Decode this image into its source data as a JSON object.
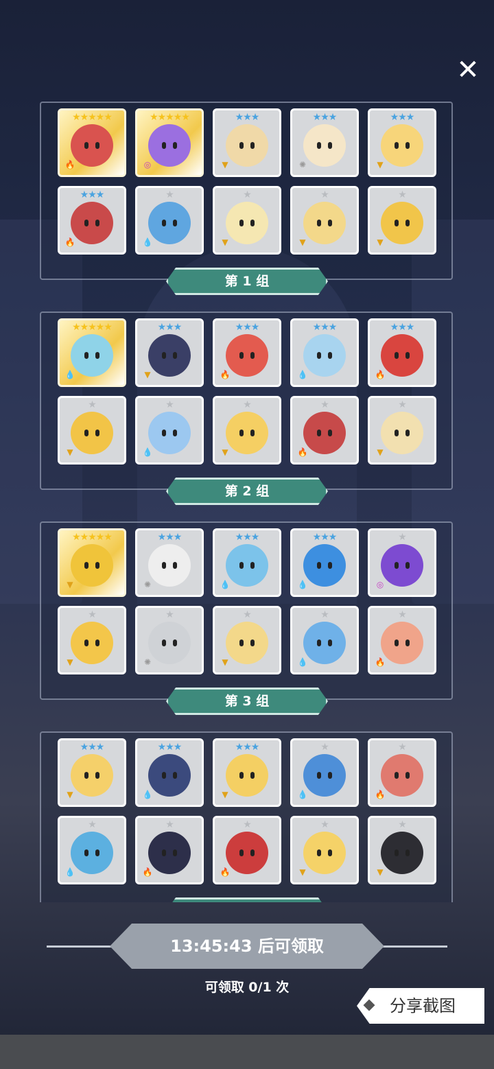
{
  "close_label": "✕",
  "groups": [
    {
      "label": "第 1 组",
      "cards": [
        {
          "stars": "★★★★★",
          "tier": "five",
          "gold": true,
          "color": "#d9534f",
          "elem": "fire"
        },
        {
          "stars": "★★★★★",
          "tier": "five",
          "gold": true,
          "color": "#9b6fe0",
          "elem": "arcane"
        },
        {
          "stars": "★★★",
          "tier": "three",
          "gold": false,
          "color": "#f0d9a8",
          "elem": "earth"
        },
        {
          "stars": "★★★",
          "tier": "three",
          "gold": false,
          "color": "#f5e6c8",
          "elem": "light"
        },
        {
          "stars": "★★★",
          "tier": "three",
          "gold": false,
          "color": "#f7d57a",
          "elem": "earth"
        },
        {
          "stars": "★★★",
          "tier": "three",
          "gold": false,
          "color": "#c94a4a",
          "elem": "fire"
        },
        {
          "stars": "★",
          "tier": "one",
          "gold": false,
          "color": "#5fa6e0",
          "elem": "water"
        },
        {
          "stars": "★",
          "tier": "one",
          "gold": false,
          "color": "#f5e7b2",
          "elem": "earth"
        },
        {
          "stars": "★",
          "tier": "one",
          "gold": false,
          "color": "#f3d88a",
          "elem": "earth"
        },
        {
          "stars": "★",
          "tier": "one",
          "gold": false,
          "color": "#f1c54a",
          "elem": "earth"
        }
      ]
    },
    {
      "label": "第 2 组",
      "cards": [
        {
          "stars": "★★★★★",
          "tier": "five",
          "gold": true,
          "color": "#8fd3e8",
          "elem": "water"
        },
        {
          "stars": "★★★",
          "tier": "three",
          "gold": false,
          "color": "#3a3f66",
          "elem": "earth"
        },
        {
          "stars": "★★★",
          "tier": "three",
          "gold": false,
          "color": "#e35b4f",
          "elem": "fire"
        },
        {
          "stars": "★★★",
          "tier": "three",
          "gold": false,
          "color": "#a8d4ef",
          "elem": "water"
        },
        {
          "stars": "★★★",
          "tier": "three",
          "gold": false,
          "color": "#d9453f",
          "elem": "fire"
        },
        {
          "stars": "★",
          "tier": "one",
          "gold": false,
          "color": "#f2c447",
          "elem": "earth"
        },
        {
          "stars": "★",
          "tier": "one",
          "gold": false,
          "color": "#9cc8f0",
          "elem": "water"
        },
        {
          "stars": "★",
          "tier": "one",
          "gold": false,
          "color": "#f5cf63",
          "elem": "earth"
        },
        {
          "stars": "★",
          "tier": "one",
          "gold": false,
          "color": "#c74a4a",
          "elem": "fire"
        },
        {
          "stars": "★",
          "tier": "one",
          "gold": false,
          "color": "#f2e0b0",
          "elem": "earth"
        }
      ]
    },
    {
      "label": "第 3 组",
      "cards": [
        {
          "stars": "★★★★★",
          "tier": "five",
          "gold": true,
          "color": "#f0c43a",
          "elem": "earth"
        },
        {
          "stars": "★★★",
          "tier": "three",
          "gold": false,
          "color": "#eeeeee",
          "elem": "light"
        },
        {
          "stars": "★★★",
          "tier": "three",
          "gold": false,
          "color": "#7cc3ea",
          "elem": "water"
        },
        {
          "stars": "★★★",
          "tier": "three",
          "gold": false,
          "color": "#3d8fe0",
          "elem": "water"
        },
        {
          "stars": "★",
          "tier": "one",
          "gold": false,
          "color": "#7d4bd1",
          "elem": "arcane"
        },
        {
          "stars": "★",
          "tier": "one",
          "gold": false,
          "color": "#f3c64a",
          "elem": "earth"
        },
        {
          "stars": "★",
          "tier": "one",
          "gold": false,
          "color": "#cfd2d6",
          "elem": "light"
        },
        {
          "stars": "★",
          "tier": "one",
          "gold": false,
          "color": "#f3d88a",
          "elem": "earth"
        },
        {
          "stars": "★",
          "tier": "one",
          "gold": false,
          "color": "#6fb1e8",
          "elem": "water"
        },
        {
          "stars": "★",
          "tier": "one",
          "gold": false,
          "color": "#f0a48a",
          "elem": "fire"
        }
      ]
    },
    {
      "label": "",
      "cards": [
        {
          "stars": "★★★",
          "tier": "three",
          "gold": false,
          "color": "#f5d06a",
          "elem": "earth"
        },
        {
          "stars": "★★★",
          "tier": "three",
          "gold": false,
          "color": "#3b4a7d",
          "elem": "water"
        },
        {
          "stars": "★★★",
          "tier": "three",
          "gold": false,
          "color": "#f4cf63",
          "elem": "earth"
        },
        {
          "stars": "★",
          "tier": "one",
          "gold": false,
          "color": "#4e8fd8",
          "elem": "water"
        },
        {
          "stars": "★",
          "tier": "one",
          "gold": false,
          "color": "#e07a6f",
          "elem": "fire"
        },
        {
          "stars": "★",
          "tier": "one",
          "gold": false,
          "color": "#5cb0e0",
          "elem": "water"
        },
        {
          "stars": "★",
          "tier": "one",
          "gold": false,
          "color": "#2d2f4a",
          "elem": "fire"
        },
        {
          "stars": "★",
          "tier": "one",
          "gold": false,
          "color": "#cc3d3d",
          "elem": "fire"
        },
        {
          "stars": "★",
          "tier": "one",
          "gold": false,
          "color": "#f5d268",
          "elem": "earth"
        },
        {
          "stars": "★",
          "tier": "one",
          "gold": false,
          "color": "#2d2d33",
          "elem": "earth"
        }
      ]
    }
  ],
  "elements": {
    "fire": {
      "glyph": "🔥",
      "color": "#e2563f"
    },
    "water": {
      "glyph": "💧",
      "color": "#2f84d8"
    },
    "earth": {
      "glyph": "▼",
      "color": "#e0a21a"
    },
    "light": {
      "glyph": "✺",
      "color": "#9a9a9a"
    },
    "arcane": {
      "glyph": "◎",
      "color": "#c43fc4"
    }
  },
  "timer": "13:45:43 后可领取",
  "claim_count": "可领取 0/1 次",
  "share_label": "分享截图"
}
